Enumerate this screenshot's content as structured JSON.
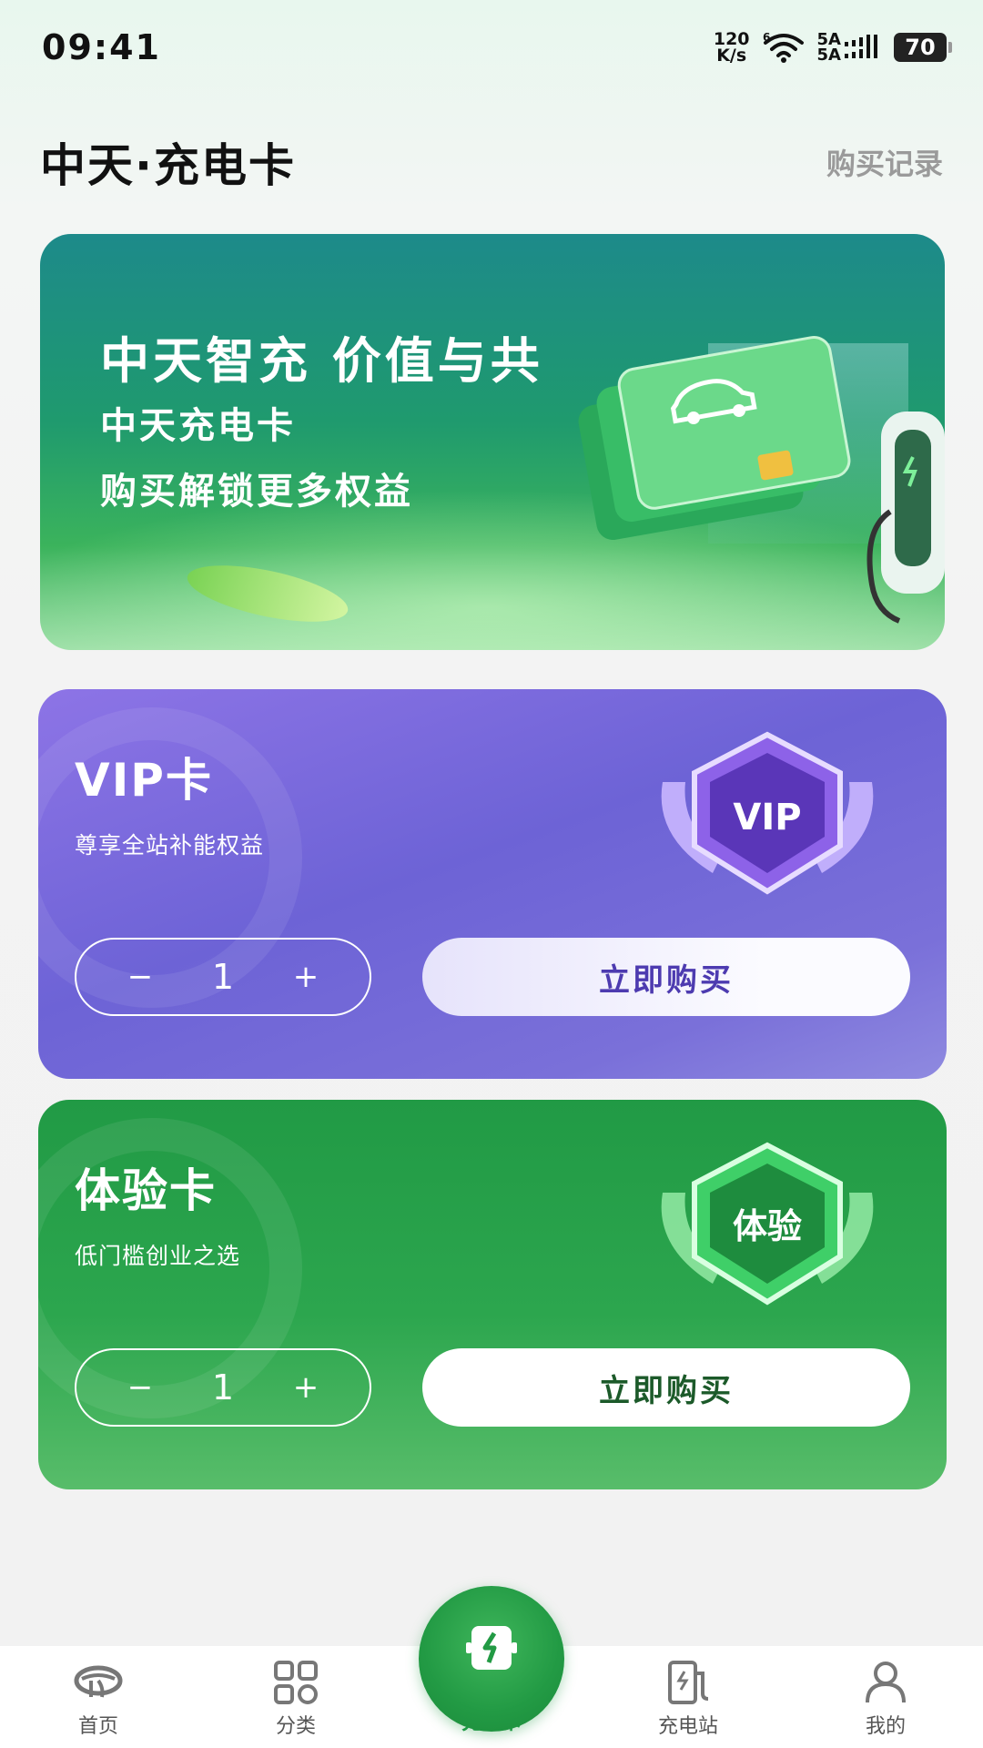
{
  "status_bar": {
    "time": "09:41",
    "net_speed_top": "120",
    "net_speed_bottom": "K/s",
    "signal_top": "5A",
    "signal_bottom": "5A",
    "wifi_label": "6",
    "battery": "70"
  },
  "header": {
    "title": "中天·充电卡",
    "purchase_record": "购买记录"
  },
  "banner": {
    "line1": "中天智充  价值与共",
    "line2": "中天充电卡",
    "line3": "购买解锁更多权益"
  },
  "cards": [
    {
      "title": "VIP卡",
      "subtitle": "尊享全站补能权益",
      "quantity": "1",
      "minus": "−",
      "plus": "+",
      "buy_label": "立即购买",
      "badge_text": "VIP"
    },
    {
      "title": "体验卡",
      "subtitle": "低门槛创业之选",
      "quantity": "1",
      "minus": "−",
      "plus": "+",
      "buy_label": "立即购买",
      "badge_text": "体验"
    }
  ],
  "nav": {
    "home": "首页",
    "category": "分类",
    "card": "充电卡",
    "station": "充电站",
    "mine": "我的"
  },
  "colors": {
    "accent_green": "#229a44",
    "vip_purple": "#6d63d6"
  }
}
